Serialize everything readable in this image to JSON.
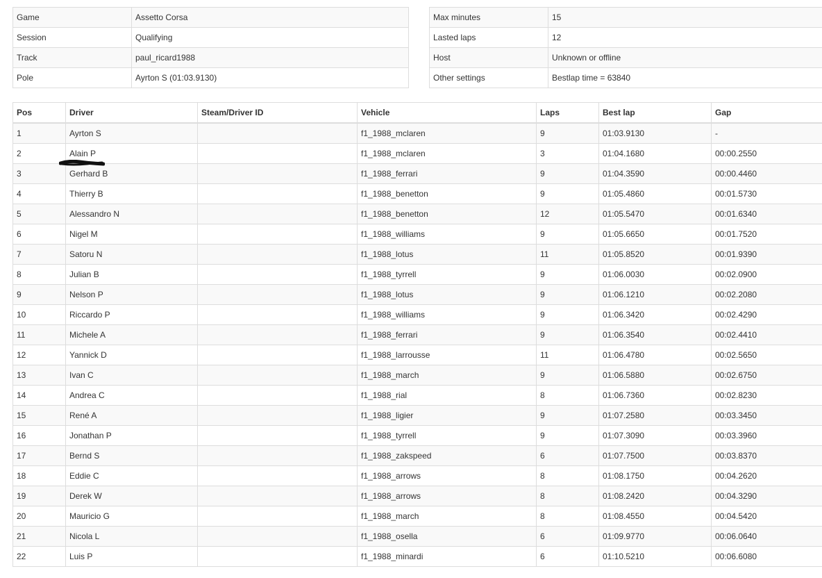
{
  "info_left": [
    {
      "label": "Game",
      "value": "Assetto Corsa"
    },
    {
      "label": "Session",
      "value": "Qualifying"
    },
    {
      "label": "Track",
      "value": "paul_ricard1988"
    },
    {
      "label": "Pole",
      "value": "Ayrton S (01:03.9130)"
    }
  ],
  "info_right": [
    {
      "label": "Max minutes",
      "value": "15"
    },
    {
      "label": "Lasted laps",
      "value": "12"
    },
    {
      "label": "Host",
      "value": "Unknown or offline"
    },
    {
      "label": "Other settings",
      "value": "Bestlap time = 63840"
    }
  ],
  "results": {
    "headers": [
      "Pos",
      "Driver",
      "Steam/Driver ID",
      "Vehicle",
      "Laps",
      "Best lap",
      "Gap"
    ],
    "rows": [
      {
        "pos": "1",
        "driver": "Ayrton S",
        "id": "",
        "vehicle": "f1_1988_mclaren",
        "laps": "9",
        "best": "01:03.9130",
        "gap": "-"
      },
      {
        "pos": "2",
        "driver": "Alain P",
        "id": "",
        "vehicle": "f1_1988_mclaren",
        "laps": "3",
        "best": "01:04.1680",
        "gap": "00:00.2550"
      },
      {
        "pos": "3",
        "driver": "Gerhard B",
        "id": "",
        "vehicle": "f1_1988_ferrari",
        "laps": "9",
        "best": "01:04.3590",
        "gap": "00:00.4460"
      },
      {
        "pos": "4",
        "driver": "Thierry B",
        "id": "",
        "vehicle": "f1_1988_benetton",
        "laps": "9",
        "best": "01:05.4860",
        "gap": "00:01.5730"
      },
      {
        "pos": "5",
        "driver": "Alessandro N",
        "id": "",
        "vehicle": "f1_1988_benetton",
        "laps": "12",
        "best": "01:05.5470",
        "gap": "00:01.6340"
      },
      {
        "pos": "6",
        "driver": "Nigel M",
        "id": "",
        "vehicle": "f1_1988_williams",
        "laps": "9",
        "best": "01:05.6650",
        "gap": "00:01.7520"
      },
      {
        "pos": "7",
        "driver": "Satoru N",
        "id": "",
        "vehicle": "f1_1988_lotus",
        "laps": "11",
        "best": "01:05.8520",
        "gap": "00:01.9390"
      },
      {
        "pos": "8",
        "driver": "Julian B",
        "id": "",
        "vehicle": "f1_1988_tyrrell",
        "laps": "9",
        "best": "01:06.0030",
        "gap": "00:02.0900"
      },
      {
        "pos": "9",
        "driver": "Nelson P",
        "id": "",
        "vehicle": "f1_1988_lotus",
        "laps": "9",
        "best": "01:06.1210",
        "gap": "00:02.2080"
      },
      {
        "pos": "10",
        "driver": "Riccardo P",
        "id": "",
        "vehicle": "f1_1988_williams",
        "laps": "9",
        "best": "01:06.3420",
        "gap": "00:02.4290"
      },
      {
        "pos": "11",
        "driver": "Michele A",
        "id": "",
        "vehicle": "f1_1988_ferrari",
        "laps": "9",
        "best": "01:06.3540",
        "gap": "00:02.4410"
      },
      {
        "pos": "12",
        "driver": "Yannick D",
        "id": "",
        "vehicle": "f1_1988_larrousse",
        "laps": "11",
        "best": "01:06.4780",
        "gap": "00:02.5650"
      },
      {
        "pos": "13",
        "driver": "Ivan C",
        "id": "",
        "vehicle": "f1_1988_march",
        "laps": "9",
        "best": "01:06.5880",
        "gap": "00:02.6750"
      },
      {
        "pos": "14",
        "driver": "Andrea C",
        "id": "",
        "vehicle": "f1_1988_rial",
        "laps": "8",
        "best": "01:06.7360",
        "gap": "00:02.8230"
      },
      {
        "pos": "15",
        "driver": "René A",
        "id": "",
        "vehicle": "f1_1988_ligier",
        "laps": "9",
        "best": "01:07.2580",
        "gap": "00:03.3450"
      },
      {
        "pos": "16",
        "driver": "Jonathan P",
        "id": "",
        "vehicle": "f1_1988_tyrrell",
        "laps": "9",
        "best": "01:07.3090",
        "gap": "00:03.3960"
      },
      {
        "pos": "17",
        "driver": "Bernd S",
        "id": "",
        "vehicle": "f1_1988_zakspeed",
        "laps": "6",
        "best": "01:07.7500",
        "gap": "00:03.8370"
      },
      {
        "pos": "18",
        "driver": "Eddie C",
        "id": "",
        "vehicle": "f1_1988_arrows",
        "laps": "8",
        "best": "01:08.1750",
        "gap": "00:04.2620"
      },
      {
        "pos": "19",
        "driver": "Derek W",
        "id": "",
        "vehicle": "f1_1988_arrows",
        "laps": "8",
        "best": "01:08.2420",
        "gap": "00:04.3290"
      },
      {
        "pos": "20",
        "driver": "Mauricio G",
        "id": "",
        "vehicle": "f1_1988_march",
        "laps": "8",
        "best": "01:08.4550",
        "gap": "00:04.5420"
      },
      {
        "pos": "21",
        "driver": "Nicola L",
        "id": "",
        "vehicle": "f1_1988_osella",
        "laps": "6",
        "best": "01:09.9770",
        "gap": "00:06.0640"
      },
      {
        "pos": "22",
        "driver": "Luis P",
        "id": "",
        "vehicle": "f1_1988_minardi",
        "laps": "6",
        "best": "01:10.5210",
        "gap": "00:06.6080"
      }
    ]
  }
}
